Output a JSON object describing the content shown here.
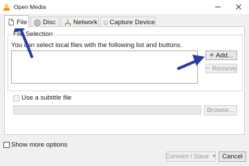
{
  "window": {
    "title": "Open Media",
    "minimize_icon": "minimize-icon",
    "close_icon": "close-icon"
  },
  "tabs": [
    {
      "label": "File",
      "icon": "file-icon"
    },
    {
      "label": "Disc",
      "icon": "disc-icon"
    },
    {
      "label": "Network",
      "icon": "network-icon"
    },
    {
      "label": "Capture Device",
      "icon": "capture-device-icon"
    }
  ],
  "file_selection": {
    "legend": "File Selection",
    "hint": "You can select local files with the following list and buttons.",
    "add_label": "Add...",
    "remove_label": "Remove"
  },
  "subtitle": {
    "checkbox_label": "Use a subtitle file",
    "browse_label": "Browse..."
  },
  "footer": {
    "show_more_label": "Show more options",
    "convert_label": "Convert / Save",
    "cancel_label": "Cancel"
  },
  "colors": {
    "annotation_arrow": "#2b3a9e",
    "vlc_cone": "#f28c00"
  }
}
